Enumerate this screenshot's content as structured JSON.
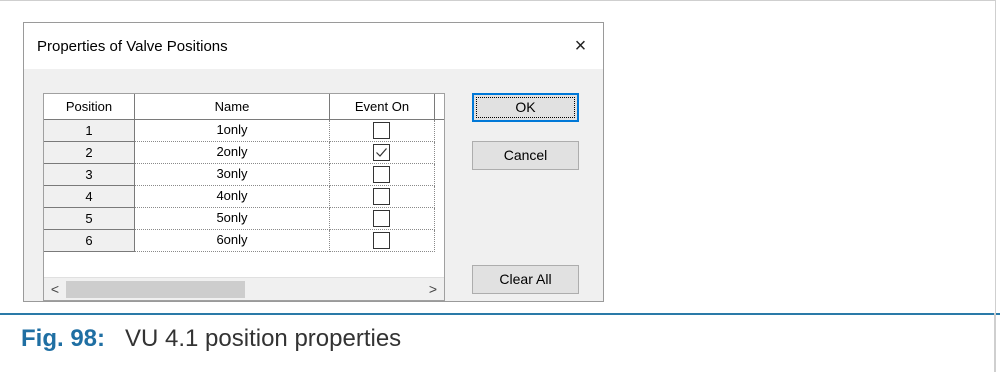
{
  "dialog": {
    "title": "Properties of Valve Positions",
    "close_symbol": "×",
    "columns": [
      "Position",
      "Name",
      "Event On"
    ],
    "rows": [
      {
        "position": "1",
        "name": "1only",
        "event_on": false
      },
      {
        "position": "2",
        "name": "2only",
        "event_on": true
      },
      {
        "position": "3",
        "name": "3only",
        "event_on": false
      },
      {
        "position": "4",
        "name": "4only",
        "event_on": false
      },
      {
        "position": "5",
        "name": "5only",
        "event_on": false
      },
      {
        "position": "6",
        "name": "6only",
        "event_on": false
      }
    ],
    "scroll_left_symbol": "<",
    "scroll_right_symbol": ">",
    "buttons": {
      "ok": "OK",
      "cancel": "Cancel",
      "clear_all": "Clear All"
    }
  },
  "caption": {
    "label": "Fig. 98:",
    "text": "VU 4.1 position properties"
  },
  "colors": {
    "caption_label": "#1f6fa3",
    "separator": "#2a7aa8",
    "focus_border": "#0078d7"
  },
  "icons": {
    "close": "close-icon",
    "checkbox": "checkbox-icon",
    "check": "check-icon",
    "scroll_left": "chevron-left-icon",
    "scroll_right": "chevron-right-icon"
  }
}
